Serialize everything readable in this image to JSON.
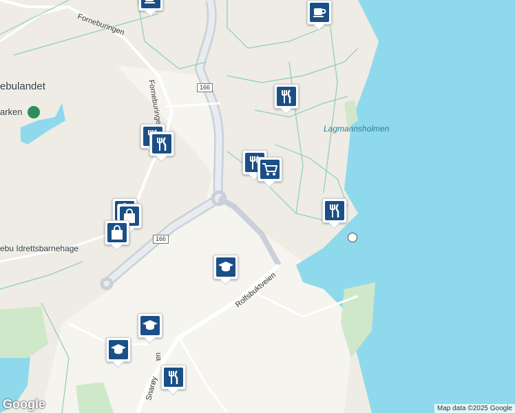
{
  "map": {
    "colors": {
      "land": "#eeece4",
      "residential": "#f6f4ee",
      "water": "#8fd9ec",
      "green": "#cfe8c9",
      "road": "#ffffff",
      "major_road": "#c9d0d8",
      "path": "#8ccfb0",
      "pin_fill": "#1b4f86"
    },
    "labels": {
      "place_left": "ebulandet",
      "park_left": "arken",
      "island": "Lagmannsholmen",
      "kindergarten": "ebu Idrettsbarnehage",
      "road_forneburingen_top": "Forneburingen",
      "road_forneburingen_vertical": "Forneburingen",
      "road_rolfsbuktveien": "Rolfsbuktveien",
      "road_snaroy": "Snarøy",
      "road_ua": "ua"
    },
    "shields": {
      "top": "166",
      "bottom": "166"
    },
    "pins": [
      {
        "kind": "cafe",
        "icon": "coffee-cup-icon"
      },
      {
        "kind": "cafe",
        "icon": "coffee-cup-icon"
      },
      {
        "kind": "restaurant",
        "icon": "fork-knife-icon"
      },
      {
        "kind": "restaurant",
        "icon": "fork-knife-icon"
      },
      {
        "kind": "restaurant",
        "icon": "fork-knife-icon"
      },
      {
        "kind": "restaurant",
        "icon": "fork-knife-icon"
      },
      {
        "kind": "grocery",
        "icon": "shopping-cart-icon"
      },
      {
        "kind": "restaurant",
        "icon": "fork-knife-icon"
      },
      {
        "kind": "shopping",
        "icon": "shopping-bag-icon"
      },
      {
        "kind": "shopping",
        "icon": "shopping-bag-icon"
      },
      {
        "kind": "shopping",
        "icon": "shopping-bag-icon"
      },
      {
        "kind": "school",
        "icon": "graduation-cap-icon"
      },
      {
        "kind": "school",
        "icon": "graduation-cap-icon"
      },
      {
        "kind": "school",
        "icon": "graduation-cap-icon"
      },
      {
        "kind": "restaurant",
        "icon": "fork-knife-icon"
      }
    ],
    "attribution": "Map data ©2025 Google",
    "logo": "Google"
  }
}
